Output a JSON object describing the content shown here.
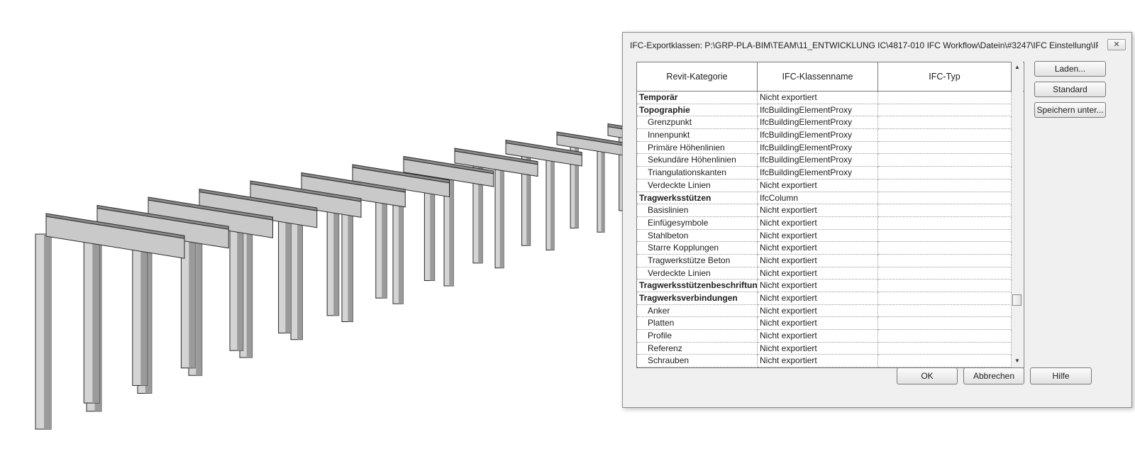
{
  "dialog": {
    "title": "IFC-Exportklassen: P:\\GRP-PLA-BIM\\TEAM\\11_ENTWICKLUNG IC\\4817-010 IFC Workflow\\Datein\\#3247\\IFC Einstellung\\IFC...",
    "close_icon": "close-icon"
  },
  "table": {
    "headers": [
      "Revit-Kategorie",
      "IFC-Klassenname",
      "IFC-Typ"
    ],
    "rows": [
      {
        "category": "Temporär",
        "ifc_class": "Nicht exportiert",
        "ifc_type": "",
        "level": 0
      },
      {
        "category": "Topographie",
        "ifc_class": "IfcBuildingElementProxy",
        "ifc_type": "",
        "level": 0
      },
      {
        "category": "Grenzpunkt",
        "ifc_class": "IfcBuildingElementProxy",
        "ifc_type": "",
        "level": 1
      },
      {
        "category": "Innenpunkt",
        "ifc_class": "IfcBuildingElementProxy",
        "ifc_type": "",
        "level": 1
      },
      {
        "category": "Primäre Höhenlinien",
        "ifc_class": "IfcBuildingElementProxy",
        "ifc_type": "",
        "level": 1
      },
      {
        "category": "Sekundäre Höhenlinien",
        "ifc_class": "IfcBuildingElementProxy",
        "ifc_type": "",
        "level": 1
      },
      {
        "category": "Triangulationskanten",
        "ifc_class": "IfcBuildingElementProxy",
        "ifc_type": "",
        "level": 1
      },
      {
        "category": "Verdeckte Linien",
        "ifc_class": "Nicht exportiert",
        "ifc_type": "",
        "level": 1
      },
      {
        "category": "Tragwerksstützen",
        "ifc_class": "IfcColumn",
        "ifc_type": "",
        "level": 0
      },
      {
        "category": "Basislinien",
        "ifc_class": "Nicht exportiert",
        "ifc_type": "",
        "level": 1
      },
      {
        "category": "Einfügesymbole",
        "ifc_class": "Nicht exportiert",
        "ifc_type": "",
        "level": 1
      },
      {
        "category": "Stahlbeton",
        "ifc_class": "Nicht exportiert",
        "ifc_type": "",
        "level": 1
      },
      {
        "category": "Starre Kopplungen",
        "ifc_class": "Nicht exportiert",
        "ifc_type": "",
        "level": 1
      },
      {
        "category": "Tragwerkstütze Beton",
        "ifc_class": "Nicht exportiert",
        "ifc_type": "",
        "level": 1
      },
      {
        "category": "Verdeckte Linien",
        "ifc_class": "Nicht exportiert",
        "ifc_type": "",
        "level": 1
      },
      {
        "category": "Tragwerksstützenbeschriftun",
        "ifc_class": "Nicht exportiert",
        "ifc_type": "",
        "level": 0
      },
      {
        "category": "Tragwerksverbindungen",
        "ifc_class": "Nicht exportiert",
        "ifc_type": "",
        "level": 0
      },
      {
        "category": "Anker",
        "ifc_class": "Nicht exportiert",
        "ifc_type": "",
        "level": 1
      },
      {
        "category": "Platten",
        "ifc_class": "Nicht exportiert",
        "ifc_type": "",
        "level": 1
      },
      {
        "category": "Profile",
        "ifc_class": "Nicht exportiert",
        "ifc_type": "",
        "level": 1
      },
      {
        "category": "Referenz",
        "ifc_class": "Nicht exportiert",
        "ifc_type": "",
        "level": 1
      },
      {
        "category": "Schrauben",
        "ifc_class": "Nicht exportiert",
        "ifc_type": "",
        "level": 1
      }
    ]
  },
  "scrollbar": {
    "up_icon": "scroll-up-arrow-icon",
    "down_icon": "scroll-down-arrow-icon",
    "up_glyph": "▲",
    "down_glyph": "▼"
  },
  "side_buttons": {
    "load": "Laden...",
    "standard": "Standard",
    "save_as": "Speichern unter..."
  },
  "bottom_buttons": {
    "ok": "OK",
    "cancel": "Abbrechen",
    "help": "Hilfe"
  },
  "viewport": {
    "content_icon": "steel-frame-3d-model"
  }
}
